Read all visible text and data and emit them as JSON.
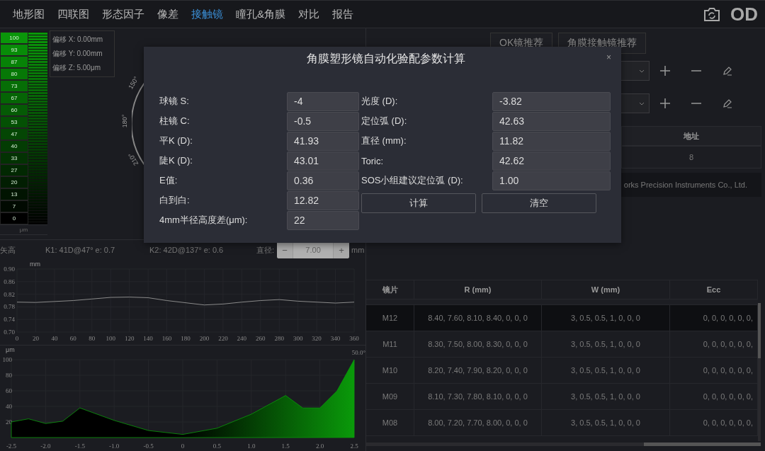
{
  "nav": {
    "tabs": [
      {
        "label": "地形图",
        "selected": false
      },
      {
        "label": "四联图",
        "selected": false
      },
      {
        "label": "形态因子",
        "selected": false
      },
      {
        "label": "像差",
        "selected": false
      },
      {
        "label": "接触镜",
        "selected": true
      },
      {
        "label": "瞳孔&角膜",
        "selected": false
      },
      {
        "label": "对比",
        "selected": false
      },
      {
        "label": "报告",
        "selected": false
      }
    ],
    "eye": "OD"
  },
  "scale": {
    "unit": "μm",
    "cells": [
      {
        "value": "100",
        "color": "#0a960a"
      },
      {
        "value": "93",
        "color": "#088c08"
      },
      {
        "value": "87",
        "color": "#078207"
      },
      {
        "value": "80",
        "color": "#067806"
      },
      {
        "value": "73",
        "color": "#066e06"
      },
      {
        "value": "67",
        "color": "#056405"
      },
      {
        "value": "60",
        "color": "#055a05"
      },
      {
        "value": "53",
        "color": "#045004"
      },
      {
        "value": "47",
        "color": "#044604"
      },
      {
        "value": "40",
        "color": "#033c03"
      },
      {
        "value": "33",
        "color": "#033203"
      },
      {
        "value": "27",
        "color": "#022802"
      },
      {
        "value": "20",
        "color": "#021e02"
      },
      {
        "value": "13",
        "color": "#011401"
      },
      {
        "value": "7",
        "color": "#010a01"
      },
      {
        "value": "0",
        "color": "#000000"
      }
    ]
  },
  "offsets": [
    "偏移 X: 0.00mm",
    "偏移 Y: 0.00mm",
    "偏移 Z: 5.00μm"
  ],
  "polar_labels": [
    "150°",
    "180°",
    "210°"
  ],
  "profile_bar": {
    "title": "矢高",
    "k1": "K1: 41D@47° e: 0.7",
    "k2": "K2: 42D@137° e: 0.6",
    "diameter_label": "直径:",
    "decrement": "−",
    "diameter": "7.00",
    "increment": "+",
    "unit": "mm"
  },
  "sag_chart": {
    "chart_data": {
      "type": "line",
      "ylabel": "mm",
      "grid": true,
      "x": [
        0,
        20,
        40,
        60,
        80,
        100,
        120,
        140,
        160,
        180,
        200,
        220,
        240,
        260,
        280,
        300,
        320,
        340,
        360
      ],
      "series": [
        {
          "color": "#8a8a8a",
          "values": [
            0.795,
            0.794,
            0.797,
            0.8,
            0.805,
            0.81,
            0.811,
            0.809,
            0.8,
            0.793,
            0.786,
            0.789,
            0.795,
            0.8,
            0.803,
            0.798,
            0.795,
            0.792,
            0.795
          ]
        }
      ],
      "xlim": [
        0,
        360
      ],
      "ylim": [
        0.7,
        0.9
      ],
      "xticks": [
        0,
        20,
        40,
        60,
        80,
        100,
        120,
        140,
        160,
        180,
        200,
        220,
        240,
        260,
        280,
        300,
        320,
        340,
        360
      ],
      "yticks": [
        {
          "value": 0.7,
          "label": "0.70"
        },
        {
          "value": 0.74,
          "label": "0.74"
        },
        {
          "value": 0.78,
          "label": "0.78"
        },
        {
          "value": 0.82,
          "label": "0.82"
        },
        {
          "value": 0.86,
          "label": "0.86"
        },
        {
          "value": 0.9,
          "label": "0.90"
        }
      ]
    }
  },
  "height_chart": {
    "chart_data": {
      "type": "area",
      "ylabel": "μm",
      "grid": true,
      "x": [
        -2.5,
        -2.25,
        -2.0,
        -1.75,
        -1.5,
        -1.0,
        -0.5,
        0,
        0.5,
        1.0,
        1.5,
        1.75,
        2.0,
        2.25,
        2.5
      ],
      "series": [
        {
          "color": "#0a9a0a",
          "values": [
            20,
            24,
            18,
            21,
            38,
            22,
            9,
            4,
            12,
            30,
            54,
            38,
            38,
            60,
            100
          ]
        }
      ],
      "xlim": [
        -2.5,
        2.5
      ],
      "ylim": [
        0,
        100
      ],
      "xticks": [
        -2.5,
        {
          "value": -2,
          "label": "-2.0"
        },
        -1.5,
        {
          "value": -1,
          "label": "-1.0"
        },
        -0.5,
        {
          "value": 0,
          "label": "0"
        },
        0.5,
        {
          "value": 1,
          "label": "1.0"
        },
        1.5,
        {
          "value": 2,
          "label": "2.0"
        },
        2.5
      ],
      "yticks": [
        20,
        40,
        60,
        80,
        100
      ],
      "annotations": [
        {
          "x": 2.5,
          "y": 100,
          "text": "50.0°"
        }
      ]
    }
  },
  "recommend_buttons": [
    "OK镜推荐",
    "角膜接触镜推荐"
  ],
  "address_table": {
    "column": "地址",
    "value": "8"
  },
  "company": "orks Precision Instruments Co., Ltd.",
  "lens_table": {
    "columns": [
      "镜片",
      "R (mm)",
      "W (mm)",
      "Ecc"
    ],
    "rows": [
      {
        "cells": [
          "M12",
          "8.40, 7.60, 8.10, 8.40, 0, 0, 0",
          "3, 0.5, 0.5, 1, 0, 0, 0",
          "0, 0, 0, 0, 0, 0,"
        ],
        "selected": true
      },
      {
        "cells": [
          "M11",
          "8.30, 7.50, 8.00, 8.30, 0, 0, 0",
          "3, 0.5, 0.5, 1, 0, 0, 0",
          "0, 0, 0, 0, 0, 0,"
        ],
        "selected": false
      },
      {
        "cells": [
          "M10",
          "8.20, 7.40, 7.90, 8.20, 0, 0, 0",
          "3, 0.5, 0.5, 1, 0, 0, 0",
          "0, 0, 0, 0, 0, 0,"
        ],
        "selected": false
      },
      {
        "cells": [
          "M09",
          "8.10, 7.30, 7.80, 8.10, 0, 0, 0",
          "3, 0.5, 0.5, 1, 0, 0, 0",
          "0, 0, 0, 0, 0, 0,"
        ],
        "selected": false
      },
      {
        "cells": [
          "M08",
          "8.00, 7.20, 7.70, 8.00, 0, 0, 0",
          "3, 0.5, 0.5, 1, 0, 0, 0",
          "0, 0, 0, 0, 0, 0,"
        ],
        "selected": false
      }
    ]
  },
  "dialog": {
    "title": "角膜塑形镜自动化验配参数计算",
    "close": "×",
    "left_fields": [
      {
        "label": "球镜 S:",
        "value": "-4"
      },
      {
        "label": "柱镜 C:",
        "value": "-0.5"
      },
      {
        "label": "平K (D):",
        "value": "41.93"
      },
      {
        "label": "陡K (D):",
        "value": "43.01"
      },
      {
        "label": "E值:",
        "value": "0.36"
      },
      {
        "label": "白到白:",
        "value": "12.82"
      },
      {
        "label": "4mm半径高度差(μm):",
        "value": "22"
      }
    ],
    "right_fields": [
      {
        "label": "光度 (D):",
        "value": "-3.82"
      },
      {
        "label": "定位弧 (D):",
        "value": "42.63"
      },
      {
        "label": "直径 (mm):",
        "value": "11.82"
      },
      {
        "label": "Toric:",
        "value": "42.62"
      },
      {
        "label": "SOS小组建议定位弧 (D):",
        "value": "1.00"
      }
    ],
    "buttons": [
      "计算",
      "清空"
    ]
  }
}
